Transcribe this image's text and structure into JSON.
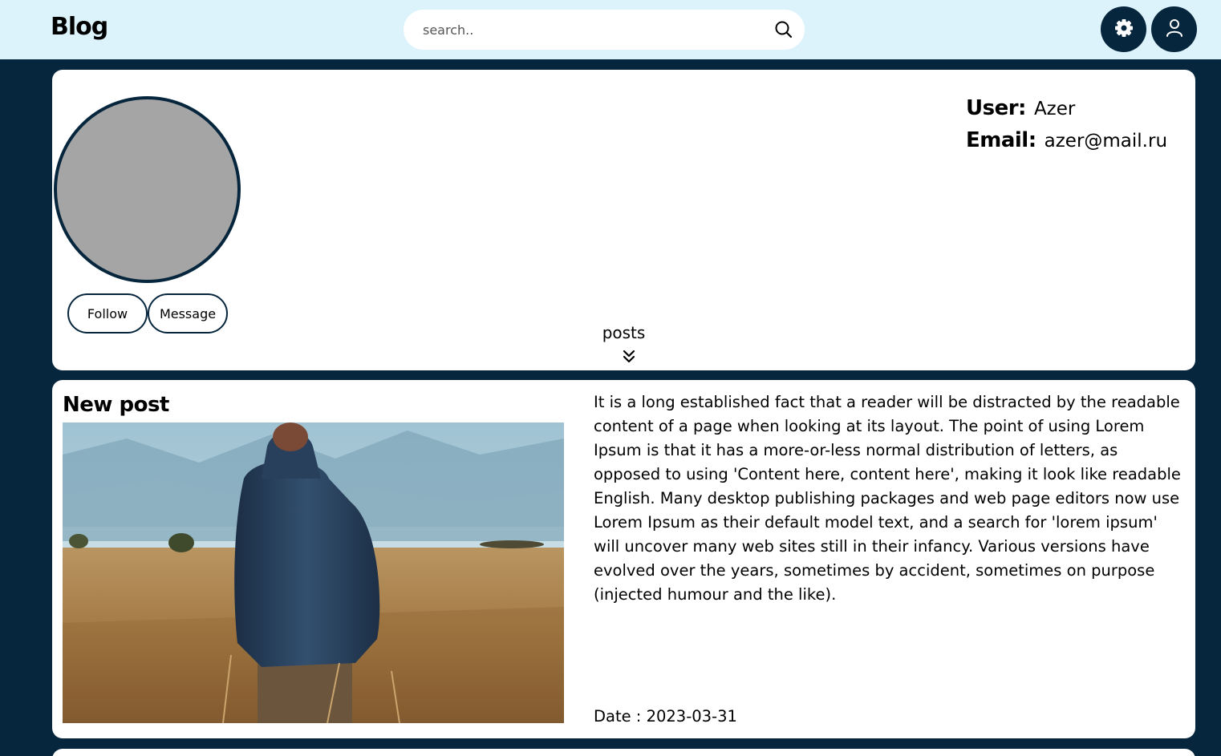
{
  "header": {
    "logo": "Blog",
    "search_placeholder": "search..",
    "search_icon": "search-icon",
    "settings_icon": "gear-icon",
    "profile_icon": "user-icon"
  },
  "profile": {
    "user_label": "User:",
    "user_value": "Azer",
    "email_label": "Email:",
    "email_value": "azer@mail.ru",
    "follow_label": "Follow",
    "message_label": "Message",
    "posts_label": "posts",
    "posts_icon": "double-chevron-down-icon"
  },
  "post": {
    "title": "New post",
    "image_alt": "photo",
    "body": "It is a long established fact that a reader will be distracted by the readable content of a page when looking at its layout. The point of using Lorem Ipsum is that it has a more-or-less normal distribution of letters, as opposed to using 'Content here, content here', making it look like readable English. Many desktop publishing packages and web page editors now use Lorem Ipsum as their default model text, and a search for 'lorem ipsum' will uncover many web sites still in their infancy. Various versions have evolved over the years, sometimes by accident, sometimes on purpose (injected humour and the like).",
    "date": "Date : 2023-03-31"
  },
  "colors": {
    "page_background": "#06263d",
    "header_background": "#ddf3fc",
    "avatar_fill": "#a6a5a6",
    "card_background": "#ffffff"
  }
}
